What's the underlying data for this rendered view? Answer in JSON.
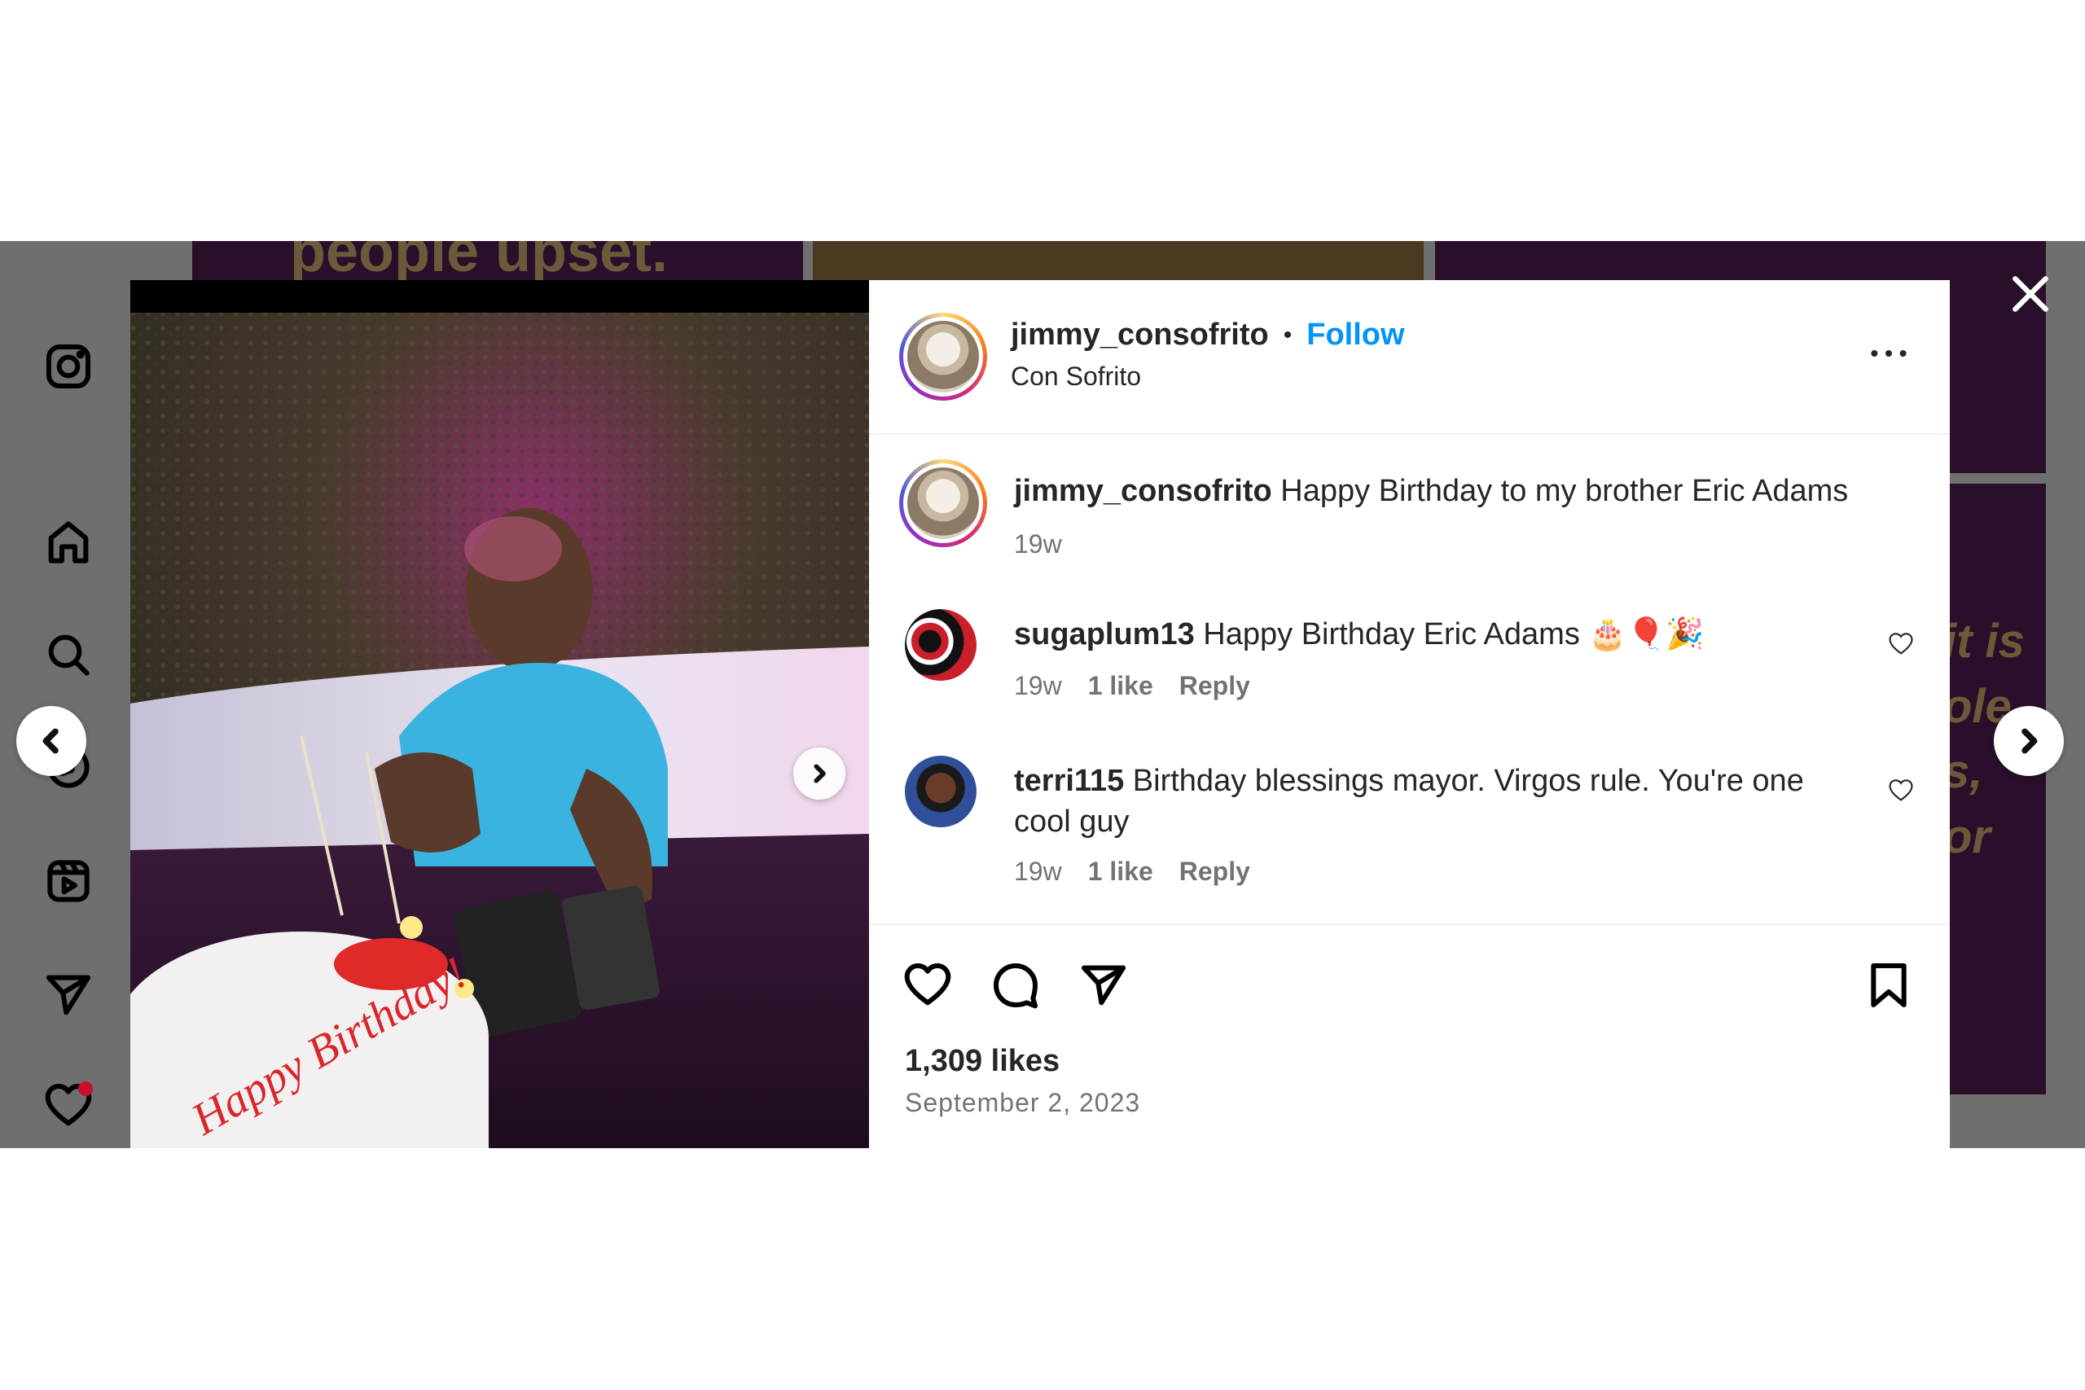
{
  "post": {
    "author": "jimmy_consofrito",
    "follow_label": "Follow",
    "separator": "•",
    "subtitle": "Con Sofrito",
    "more_icon": "more-horizontal-icon"
  },
  "caption": {
    "username": "jimmy_consofrito",
    "text": "Happy Birthday to my brother Eric Adams",
    "time": "19w"
  },
  "comments": [
    {
      "username": "sugaplum13",
      "text": "Happy Birthday Eric Adams 🎂🎈🎉",
      "time": "19w",
      "likes": "1 like",
      "reply": "Reply"
    },
    {
      "username": "terri115",
      "text": "Birthday blessings mayor. Virgos rule. You're one cool guy",
      "time": "19w",
      "likes": "1 like",
      "reply": "Reply"
    }
  ],
  "stats": {
    "likes": "1,309 likes",
    "date": "September 2, 2023"
  },
  "photo": {
    "cake_text": "Happy Birthday!"
  },
  "background_text": {
    "top_left": "people upset.",
    "right_lines": [
      "it is",
      "ole",
      "s,",
      "or"
    ]
  },
  "nav": [
    "instagram-icon",
    "home-icon",
    "search-icon",
    "explore-icon",
    "reels-icon",
    "direct-message-icon",
    "notifications-heart-icon"
  ],
  "colors": {
    "follow": "#0095f6",
    "text": "#262626",
    "muted": "#737373",
    "overlay": "#6f6f6f",
    "notification": "#c8102e"
  }
}
